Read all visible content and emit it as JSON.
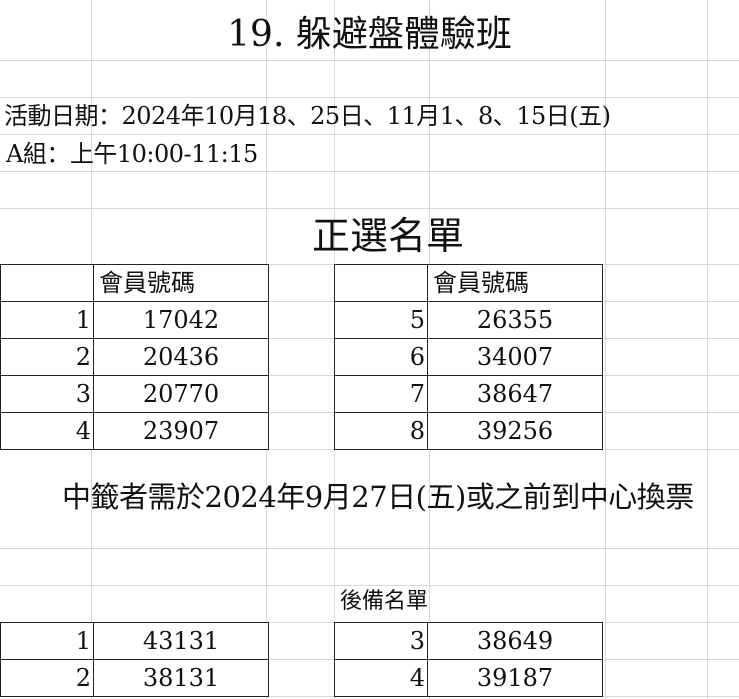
{
  "title": "19. 躲避盤體驗班",
  "activity_dates": "活動日期：2024年10月18、25日、11月1、8、15日(五)",
  "group_time": "A組：上午10:00-11:15",
  "selected_heading": "正選名單",
  "selected": {
    "left": {
      "header": "會員號碼",
      "rows": [
        {
          "idx": "1",
          "number": "17042"
        },
        {
          "idx": "2",
          "number": "20436"
        },
        {
          "idx": "3",
          "number": "20770"
        },
        {
          "idx": "4",
          "number": "23907"
        }
      ]
    },
    "right": {
      "header": "會員號碼",
      "rows": [
        {
          "idx": "5",
          "number": "26355"
        },
        {
          "idx": "6",
          "number": "34007"
        },
        {
          "idx": "7",
          "number": "38647"
        },
        {
          "idx": "8",
          "number": "39256"
        }
      ]
    }
  },
  "notice": "中籤者需於2024年9月27日(五)或之前到中心換票",
  "waitlist_heading": "後備名單",
  "waitlist": {
    "left": {
      "rows": [
        {
          "idx": "1",
          "number": "43131"
        },
        {
          "idx": "2",
          "number": "38131"
        }
      ]
    },
    "right": {
      "rows": [
        {
          "idx": "3",
          "number": "38649"
        },
        {
          "idx": "4",
          "number": "39187"
        }
      ]
    }
  }
}
